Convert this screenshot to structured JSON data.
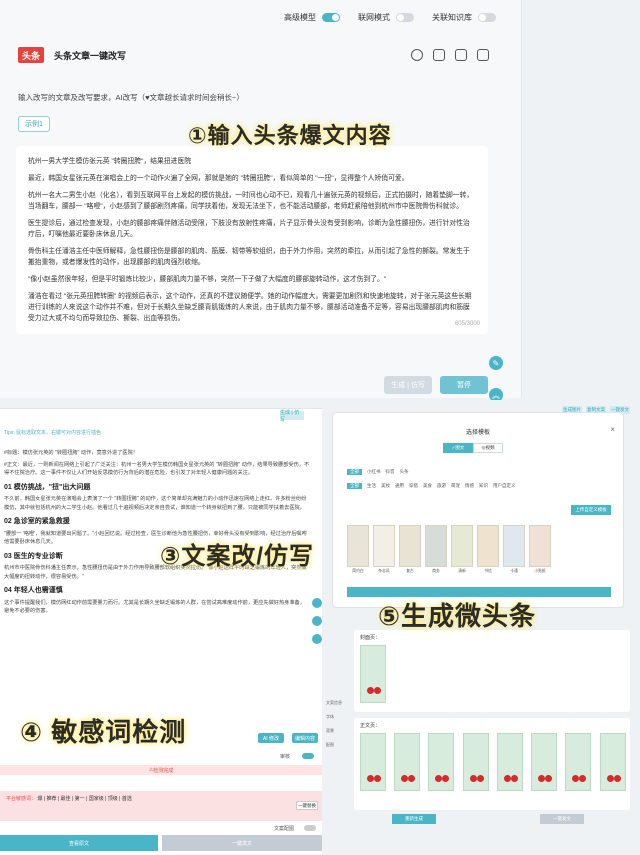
{
  "toggles": [
    {
      "label": "高级模型",
      "on": true
    },
    {
      "label": "联网模式",
      "on": false
    },
    {
      "label": "关联知识库",
      "on": false
    }
  ],
  "app": {
    "logo": "头条",
    "title": "头条文章一键改写"
  },
  "intro": "输入改写的文章及改写要求，AI改写（♥文章越长请求时间会稍长~）",
  "example_tab": "示例1",
  "article": {
    "title": "杭州一男大学生模仿张元英 \"转圈扭胯\"，结果扭进医院",
    "paragraphs": [
      "最近，韩国女星张元英在演唱会上的一个动作火遍了全网，那就是她的 \"转圈扭胯\"，看似简单的 \"一扭\"，显得整个人矫俏可爱。",
      "杭州一名大二男生小赵（化名），看到互联网平台上发起的模仿挑战，一时间也心动不已，观看几十遍张元英的视频后，正式拍摄时，随着垫脚一转，当场翻车，腰部一 \"咯噔\"，小赵感到了腰部剧烈疼痛，同学扶着他，发现无法坐下，也不能活动腰部，老师赶紧陪他到杭州市中医院骨伤科就诊。",
      "医生提诊后，通过检查发现，小赵的腰部疼痛伴随活动受限，下肢没有放射性疼痛，片子显示骨头没有受到影响，诊断为急性腰扭伤，进行针对性治疗后，叮嘱他最近要卧床休息几天。",
      "骨伤科主任潘浩主任中医师解释，急性腰扭伤是腰部的肌肉、筋膜、韧带等软组织，由于外力作用，突然的牵拉，从而引起了急性的撕裂。常发生于搬抬重物，或者爆发性的动作，出现腰部的肌肉强烈收缩。",
      "\"像小赵虽然很年轻，但是平时锻炼比较少，腰部肌肉力量不够，突然一下子做了大幅度的腰部旋转动作，这才伤到了。\"",
      "潘浩在看过 \"张元英扭胯转圈\" 的视频后表示，这个动作，还真的不建议随便学。她的动作幅度大，需要更加剧烈和快速地旋转，对于张元英这些长期进行训练的人来说这个动作并不难，但对于长期久坐缺乏腰背肌锻炼的人来说，由于肌肉力量不够，腰部活动准备不足等，容易出现腰部肌肉和筋膜受力过大或不均匀而导致拉伤、撕裂、出血等损伤。"
    ],
    "char_count": "605/3000"
  },
  "buttons": {
    "generate": "生成 | 仿写",
    "pause": "暂停"
  },
  "annotations": [
    "①输入头条爆文内容",
    "③文案改/仿写",
    "④ 敏感词检测",
    "⑤生成微头条"
  ],
  "left_panel": {
    "tag": "生成 | 仿写",
    "tip": "Tips: 鼠标选取文本，右键可对内容进行插色",
    "intro_title": "#标题：模仿张元英的 \"转圈扭胯\" 动作，竟意外进了医院！",
    "intro_body": "#正文：最近，一则新闻在网络上引起了广泛关注：杭州一名男大学生模仿韩国女星张元英的 \"转圈扭胯\" 动作，结果导致腰部受伤，不得不住院治疗。这一事件不仅让人们开始反思模仿行为背后的潜在危险，也引发了对年轻人健康问题的关注。",
    "sections": [
      {
        "heading": "01 模仿挑战，\"扭\"出大问题",
        "body": "不久前，韩国女星张元英在演唱会上表演了一个 \"转圈扭胯\" 的动作，这个简单却充满魅力的小动作迅速在网络上走红。许多粉丝纷纷模仿，其中就包括杭州的大二学生小赵。他看过几十遍视频后决定亲自尝试，谁知道一个转身就扭到了腰，只能被同学扶着去医院。"
      },
      {
        "heading": "02 急诊室的紧急救援",
        "body": "\"腰部一 '咯噔'，我就知道要出问题了。\"小赵回忆说。经过检查，医生诊断他为急性腰扭伤，幸好骨头没有受到影响，经过治疗后嘱咐他需要卧床休息几天。"
      },
      {
        "heading": "03 医生的专业诊断",
        "body": "杭州市中医院骨伤科潘主任表示，急性腰扭伤是由于外力作用导致腰部软组织突然拉伤。\"像小赵这样平时缺乏锻炼的年轻人，突然做大幅度的扭转动作，很容易受伤。\""
      },
      {
        "heading": "04 年轻人也需谨慎",
        "body": "这个事件提醒我们，模仿网红动作前需要量力而行。尤其是长期久坐缺乏锻炼的人群，在尝试高难度动作前，更应先做好热身准备，避免不必要的伤害。"
      }
    ],
    "btn_ai": "AI 修改",
    "btn_edit": "编辑内容",
    "switch_label": "审核",
    "red_bar": "检测完成",
    "sensitive_label": "平台敏感词：",
    "sensitive_words": "爆 | 推荐 | 最佳 | 第一 | 国家级 | 顶级 | 首选",
    "sensitive_btn": "一键替换",
    "switch2_label": "文案配图",
    "bottom_left": "查看原文",
    "bottom_right": "一键发文"
  },
  "modal": {
    "title": "选择模板",
    "close": "×",
    "segments": [
      "✓图文",
      "◎视频"
    ],
    "row1": [
      "全部",
      "小红书",
      "抖音",
      "头条"
    ],
    "row2": [
      "全部",
      "生活",
      "美妆",
      "通用",
      "穿搭",
      "美食",
      "旅游",
      "萌宠",
      "情感",
      "知识",
      "用户自定义"
    ],
    "upload": "上传自定义模板",
    "thumbs": [
      "简约白",
      "杂志风",
      "复古",
      "商务",
      "清新",
      "书信",
      "卡通",
      "小贴纸"
    ],
    "confirm": "确定"
  },
  "right_panel": {
    "tabs": [
      "生成图片",
      "复制文案",
      "一键发文"
    ],
    "cover_label": "封面页：",
    "content_label": "正文页：",
    "side_items": [
      "文案信息",
      "字体",
      "背景",
      "配图"
    ],
    "btn_left": "重新生成",
    "btn_right": "一键发文",
    "card_count": 8
  },
  "colors": {
    "accent": "#4ab5c7",
    "logo_red": "#e8403a",
    "warn": "#e45050"
  }
}
